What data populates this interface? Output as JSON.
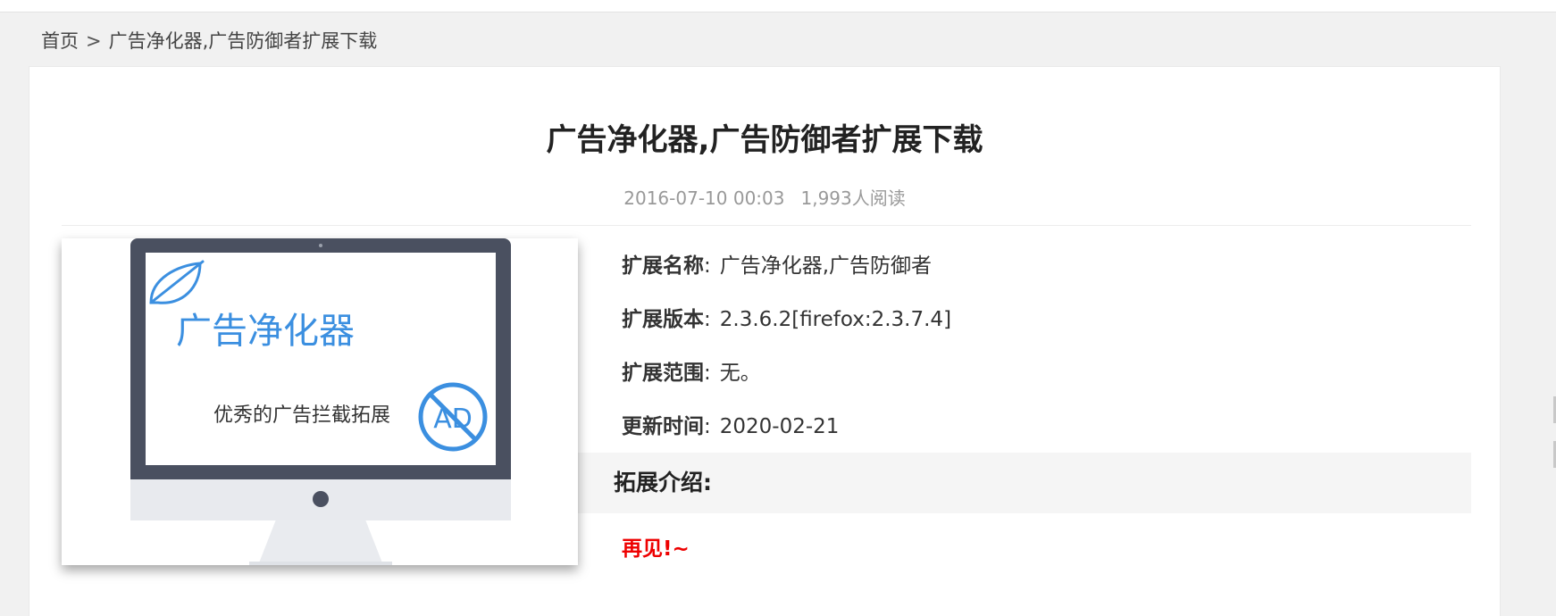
{
  "breadcrumb": {
    "home": "首页",
    "separator": ">",
    "current": "广告净化器,广告防御者扩展下载"
  },
  "article": {
    "title": "广告净化器,广告防御者扩展下载",
    "date": "2016-07-10 00:03",
    "reads": "1,993人阅读"
  },
  "cover": {
    "app_name": "广告净化器",
    "tagline": "优秀的广告拦截拓展",
    "badge_text": "AD",
    "icons": [
      "leaf-icon",
      "no-ad-icon"
    ]
  },
  "info": [
    {
      "key": "扩展名称",
      "colon": ":",
      "value": "广告净化器,广告防御者"
    },
    {
      "key": "扩展版本",
      "colon": ":",
      "value": "2.3.6.2[firefox:2.3.7.4]"
    },
    {
      "key": "扩展范围",
      "colon": ":",
      "value": "无。"
    },
    {
      "key": "更新时间",
      "colon": ":",
      "value": "2020-02-21"
    }
  ],
  "intro": {
    "heading": "拓展介绍:",
    "body": "再见!~"
  },
  "colors": {
    "accent": "#1ea3e8",
    "highlight_text": "#ee0000",
    "brand_blue": "#3b8fe0",
    "monitor_frame": "#4a5060"
  }
}
